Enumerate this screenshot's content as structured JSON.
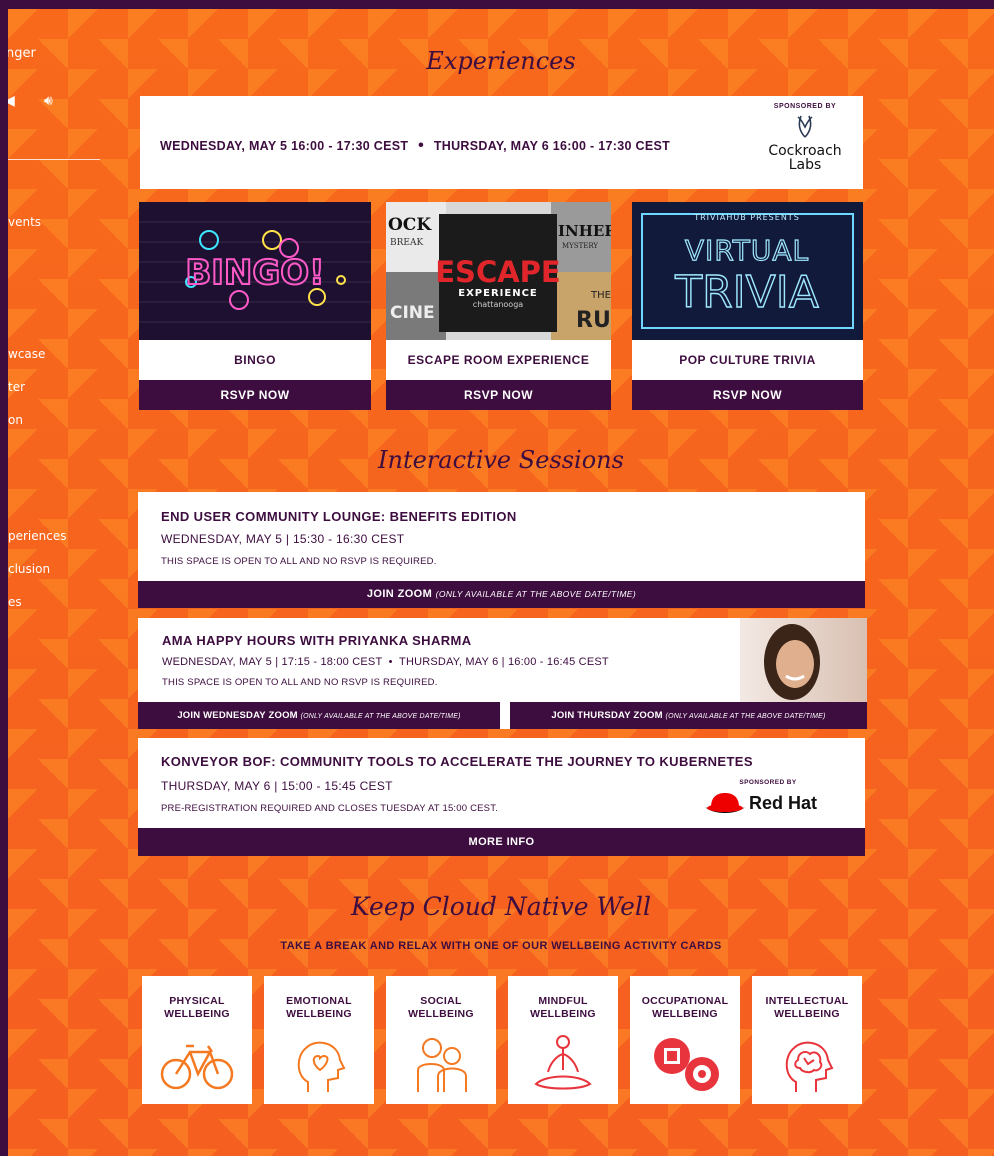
{
  "sidebar": {
    "title_fragment": "nger",
    "items": [
      "vents",
      "wcase",
      "ter",
      "on",
      "periences",
      "clusion",
      "es"
    ]
  },
  "experiences": {
    "title": "Experiences",
    "date_1": "WEDNESDAY, MAY 5 16:00 - 17:30 CEST",
    "date_2": "THURSDAY, MAY 6 16:00 - 17:30 CEST",
    "sponsored_by": "SPONSORED BY",
    "sponsor": "Cockroach Labs",
    "cards": [
      {
        "name": "BINGO",
        "rsvp": "RSVP NOW",
        "image_text": "BINGO!"
      },
      {
        "name": "ESCAPE ROOM EXPERIENCE",
        "rsvp": "RSVP NOW",
        "image_text": "ESCAPE",
        "image_sub": "EXPERIENCE",
        "image_sub2": "chattanooga",
        "frag_1": "OCK",
        "frag_2": "BREAK",
        "frag_3": "INHERI",
        "frag_4": "MYSTERY",
        "frag_5": "CINE",
        "frag_6": "THE",
        "frag_7": "RUN"
      },
      {
        "name": "POP CULTURE TRIVIA",
        "rsvp": "RSVP NOW",
        "image_top": "TRIVIAHUB PRESENTS",
        "image_text_1": "VIRTUAL",
        "image_text_2": "TRIVIA"
      }
    ]
  },
  "interactive": {
    "title": "Interactive Sessions",
    "sessions": [
      {
        "title": "END USER COMMUNITY LOUNGE: BENEFITS EDITION",
        "time": "WEDNESDAY, MAY 5 | 15:30 - 16:30 CEST",
        "note": "THIS SPACE IS OPEN TO ALL AND NO RSVP IS REQUIRED.",
        "button": "JOIN ZOOM",
        "button_note": "(ONLY AVAILABLE AT THE ABOVE DATE/TIME)"
      },
      {
        "title": "AMA HAPPY HOURS WITH PRIYANKA SHARMA",
        "time": "WEDNESDAY, MAY 5 | 17:15 - 18:00 CEST  •  THURSDAY, MAY 6 | 16:00 - 16:45 CEST",
        "note": "THIS SPACE IS OPEN TO ALL AND NO RSVP IS REQUIRED.",
        "button_1": "JOIN WEDNESDAY ZOOM",
        "button_2": "JOIN THURSDAY ZOOM",
        "button_note": "(ONLY AVAILABLE AT THE ABOVE DATE/TIME)"
      },
      {
        "title": "KONVEYOR BOF: COMMUNITY TOOLS TO ACCELERATE THE JOURNEY TO KUBERNETES",
        "time": "THURSDAY, MAY 6 | 15:00 - 15:45 CEST",
        "note": "PRE-REGISTRATION REQUIRED AND CLOSES TUESDAY AT 15:00 CEST.",
        "sponsored_by": "SPONSORED BY",
        "sponsor": "Red Hat",
        "button": "MORE INFO"
      }
    ]
  },
  "wellbeing": {
    "title": "Keep Cloud Native Well",
    "subtitle": "TAKE A BREAK AND RELAX WITH ONE OF OUR WELLBEING ACTIVITY CARDS",
    "cards": [
      {
        "line1": "PHYSICAL",
        "line2": "WELLBEING",
        "icon": "bicycle-icon"
      },
      {
        "line1": "EMOTIONAL",
        "line2": "WELLBEING",
        "icon": "head-heart-icon"
      },
      {
        "line1": "SOCIAL",
        "line2": "WELLBEING",
        "icon": "people-icon"
      },
      {
        "line1": "MINDFUL",
        "line2": "WELLBEING",
        "icon": "meditation-icon"
      },
      {
        "line1": "OCCUPATIONAL",
        "line2": "WELLBEING",
        "icon": "gears-icon"
      },
      {
        "line1": "INTELLECTUAL",
        "line2": "WELLBEING",
        "icon": "brain-icon"
      }
    ]
  },
  "colors": {
    "purple": "#3d0d3f",
    "orange": "#f5641e",
    "icon_orange": "#f47920",
    "icon_red": "#e8343c"
  }
}
